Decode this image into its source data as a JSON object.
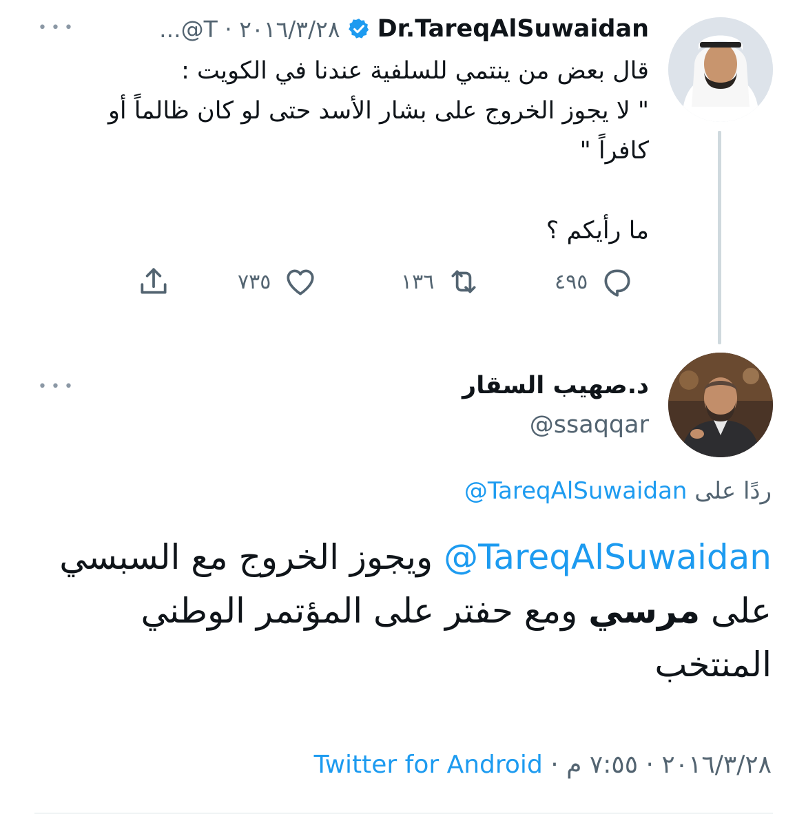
{
  "tweet1": {
    "display_name": "Dr.TareqAlSuwaidan",
    "meta": "...@T · ٢٠١٦/٣/٢٨",
    "text_lines": [
      "قال بعض من ينتمي للسلفية عندنا في الكويت :",
      "\" لا يجوز الخروج على بشار الأسد حتى لو كان ظالماً أو",
      "كافراً \""
    ],
    "question": "ما رأيكم ؟",
    "reply_count": "٤٩٥",
    "retweet_count": "١٣٦",
    "like_count": "٧٣٥",
    "verified": true
  },
  "tweet2": {
    "display_name": "د.صهيب السقار",
    "handle": "@ssaqqar",
    "reply_prefix": "ردًا على",
    "reply_to": "@TareqAlSuwaidan",
    "mention": "@TareqAlSuwaidan",
    "text_part1": "ويجوز الخروج مع",
    "text_part2": "السبسي على",
    "text_bold": "مرسي",
    "text_part3": "ومع حفتر على المؤتمر",
    "text_part4": "الوطني المنتخب",
    "date": "٢٠١٦/٣/٢٨",
    "time": "٧:٥٥ م",
    "separator": "·",
    "source": "Twitter for Android"
  },
  "more_glyph": "•••",
  "colors": {
    "accent": "#1d9bf0",
    "muted": "#536471",
    "text": "#0f1419",
    "thread": "#cfd9de"
  }
}
